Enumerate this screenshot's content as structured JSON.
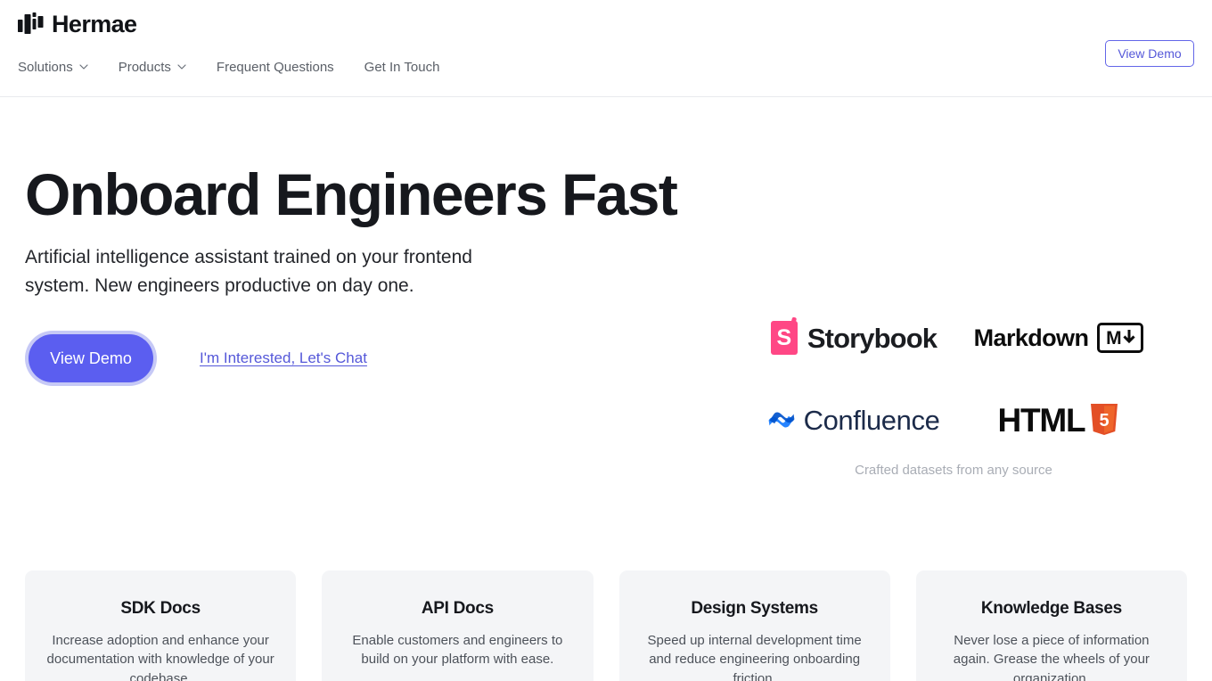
{
  "header": {
    "brand_name": "Hermae",
    "brand_mark_icon": "bar-chart-logo-icon",
    "nav_items": [
      {
        "label": "Solutions",
        "has_dropdown": true,
        "icon": "chevron-down-icon"
      },
      {
        "label": "Products",
        "has_dropdown": true,
        "icon": "chevron-down-icon"
      },
      {
        "label": "Frequent Questions",
        "has_dropdown": false
      },
      {
        "label": "Get In Touch",
        "has_dropdown": false
      }
    ],
    "cta_label": "View Demo"
  },
  "hero": {
    "title": "Onboard Engineers Fast",
    "subtitle": "Artificial intelligence assistant trained on your frontend system. New engineers productive on day one.",
    "primary_cta": "View Demo",
    "secondary_link": "I'm Interested, Let's Chat"
  },
  "logo_cloud": {
    "caption": "Crafted datasets from any source",
    "logos": [
      {
        "name": "Storybook",
        "icon": "storybook-logo-icon",
        "mark_letter": "S",
        "color": "#ff4785"
      },
      {
        "name": "Markdown",
        "icon": "markdown-logo-icon",
        "badge_letter": "M",
        "color": "#0c0c0c"
      },
      {
        "name": "Confluence",
        "icon": "confluence-logo-icon",
        "color": "#2684ff"
      },
      {
        "name": "HTML",
        "icon": "html5-logo-icon",
        "shield_number": "5",
        "color": "#e34f26"
      }
    ]
  },
  "cards": [
    {
      "title": "SDK Docs",
      "description": "Increase adoption and enhance your documentation with knowledge of your codebase."
    },
    {
      "title": "API Docs",
      "description": "Enable customers and engineers to build on your platform with ease."
    },
    {
      "title": "Design Systems",
      "description": "Speed up internal development time and reduce engineering onboarding friction."
    },
    {
      "title": "Knowledge Bases",
      "description": "Never lose a piece of information again. Grease the wheels of your organization."
    }
  ],
  "theme": {
    "accent": "#5b5ef0",
    "accent_soft": "#c6c9f6",
    "card_bg": "#f4f5f7",
    "text": "#16181d",
    "muted": "#5b6068"
  }
}
